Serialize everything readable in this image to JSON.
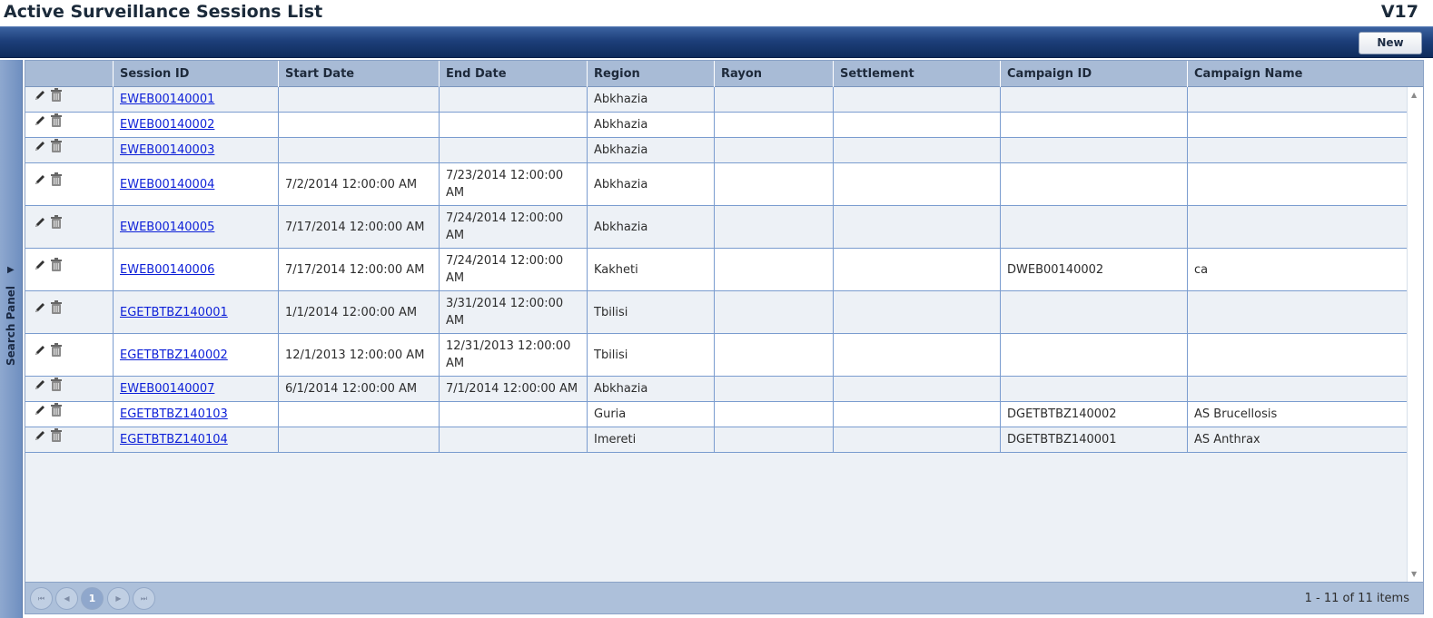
{
  "window": {
    "title": "Active Surveillance Sessions List",
    "version": "V17"
  },
  "toolbar": {
    "new_label": "New"
  },
  "search_panel": {
    "label": "Search Panel",
    "arrow": "▶"
  },
  "grid": {
    "columns": [
      "Session ID",
      "Start Date",
      "End Date",
      "Region",
      "Rayon",
      "Settlement",
      "Campaign ID",
      "Campaign Name"
    ],
    "rows": [
      {
        "session_id": "EWEB00140001",
        "start_date": "",
        "end_date": "",
        "region": "Abkhazia",
        "rayon": "",
        "settlement": "",
        "campaign_id": "",
        "campaign_name": ""
      },
      {
        "session_id": "EWEB00140002",
        "start_date": "",
        "end_date": "",
        "region": "Abkhazia",
        "rayon": "",
        "settlement": "",
        "campaign_id": "",
        "campaign_name": ""
      },
      {
        "session_id": "EWEB00140003",
        "start_date": "",
        "end_date": "",
        "region": "Abkhazia",
        "rayon": "",
        "settlement": "",
        "campaign_id": "",
        "campaign_name": ""
      },
      {
        "session_id": "EWEB00140004",
        "start_date": "7/2/2014 12:00:00 AM",
        "end_date": "7/23/2014 12:00:00 AM",
        "region": "Abkhazia",
        "rayon": "",
        "settlement": "",
        "campaign_id": "",
        "campaign_name": ""
      },
      {
        "session_id": "EWEB00140005",
        "start_date": "7/17/2014 12:00:00 AM",
        "end_date": "7/24/2014 12:00:00 AM",
        "region": "Abkhazia",
        "rayon": "",
        "settlement": "",
        "campaign_id": "",
        "campaign_name": ""
      },
      {
        "session_id": "EWEB00140006",
        "start_date": "7/17/2014 12:00:00 AM",
        "end_date": "7/24/2014 12:00:00 AM",
        "region": "Kakheti",
        "rayon": "",
        "settlement": "",
        "campaign_id": "DWEB00140002",
        "campaign_name": "ca"
      },
      {
        "session_id": "EGETBTBZ140001",
        "start_date": "1/1/2014 12:00:00 AM",
        "end_date": "3/31/2014 12:00:00 AM",
        "region": "Tbilisi",
        "rayon": "",
        "settlement": "",
        "campaign_id": "",
        "campaign_name": ""
      },
      {
        "session_id": "EGETBTBZ140002",
        "start_date": "12/1/2013 12:00:00 AM",
        "end_date": "12/31/2013 12:00:00 AM",
        "region": "Tbilisi",
        "rayon": "",
        "settlement": "",
        "campaign_id": "",
        "campaign_name": ""
      },
      {
        "session_id": "EWEB00140007",
        "start_date": "6/1/2014 12:00:00 AM",
        "end_date": "7/1/2014 12:00:00 AM",
        "region": "Abkhazia",
        "rayon": "",
        "settlement": "",
        "campaign_id": "",
        "campaign_name": ""
      },
      {
        "session_id": "EGETBTBZ140103",
        "start_date": "",
        "end_date": "",
        "region": "Guria",
        "rayon": "",
        "settlement": "",
        "campaign_id": "DGETBTBZ140002",
        "campaign_name": "AS Brucellosis"
      },
      {
        "session_id": "EGETBTBZ140104",
        "start_date": "",
        "end_date": "",
        "region": "Imereti",
        "rayon": "",
        "settlement": "",
        "campaign_id": "DGETBTBZ140001",
        "campaign_name": "AS Anthrax"
      }
    ]
  },
  "pager": {
    "current_page": "1",
    "info": "1 - 11 of 11 items"
  },
  "colors": {
    "toolbar": "#1d3f7a",
    "header": "#a8bbd6",
    "link": "#0c1fd8",
    "row_alt": "#edf1f6"
  }
}
